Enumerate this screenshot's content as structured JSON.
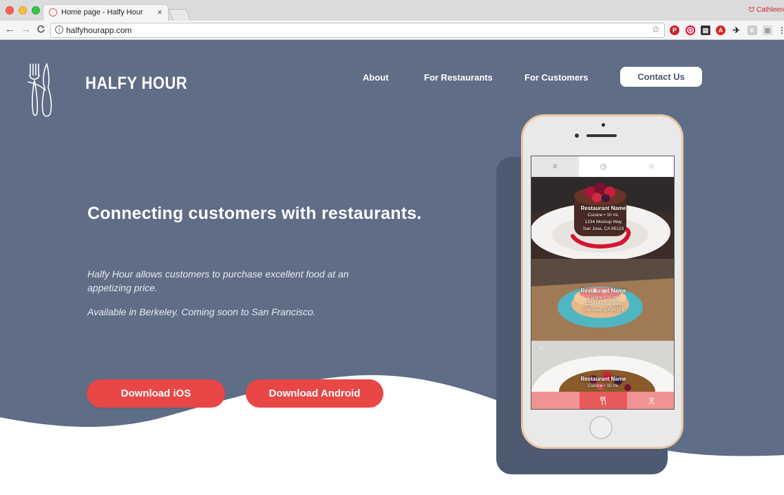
{
  "browser": {
    "tab_title": "Home page - Halfy Hour",
    "tab_close": "×",
    "url": "halfyhourapp.com",
    "profile_name": "Cathleen",
    "back": "←",
    "forward": "→",
    "reload": "C",
    "star": "☆",
    "info": "i"
  },
  "header": {
    "brand": "HALFY HOUR",
    "nav": [
      "About",
      "For Restaurants",
      "For Customers"
    ],
    "contact": "Contact Us"
  },
  "hero": {
    "headline": "Connecting customers with restaurants.",
    "description": "Halfy Hour allows customers to purchase excellent food at an appetizing price.",
    "availability": "Available in Berkeley. Coming soon to San Francisco.",
    "ios_button": "Download iOS",
    "android_button": "Download Android"
  },
  "app": {
    "top_tabs": [
      "≡",
      "◷",
      "☆"
    ],
    "cards": [
      {
        "name": "Restaurant Name",
        "cuisine": "Cuisine • 10 mi.",
        "address1": "1234 Mockup Way",
        "address2": "San Jose, CA 95123"
      },
      {
        "name": "Restaurant Name",
        "cuisine": "Cuisine • 10 mi.",
        "address1": "1234 Mockup Way",
        "address2": "San Jose, CA 95123"
      },
      {
        "name": "Restaurant Name",
        "cuisine": "Cuisine • 10 mi.",
        "address1": "",
        "address2": ""
      }
    ],
    "bottom_tabs": [
      "",
      "🍴",
      "⚇"
    ]
  },
  "colors": {
    "hero_bg": "#5f6d87",
    "accent": "#e94646",
    "phone_frame": "#e9c7a5"
  },
  "icons": [
    "back-arrow-icon",
    "forward-arrow-icon",
    "reload-icon",
    "info-icon",
    "star-icon",
    "fork-knife-logo-icon",
    "menu-icon",
    "clock-icon",
    "favorite-icon",
    "utensils-icon"
  ]
}
